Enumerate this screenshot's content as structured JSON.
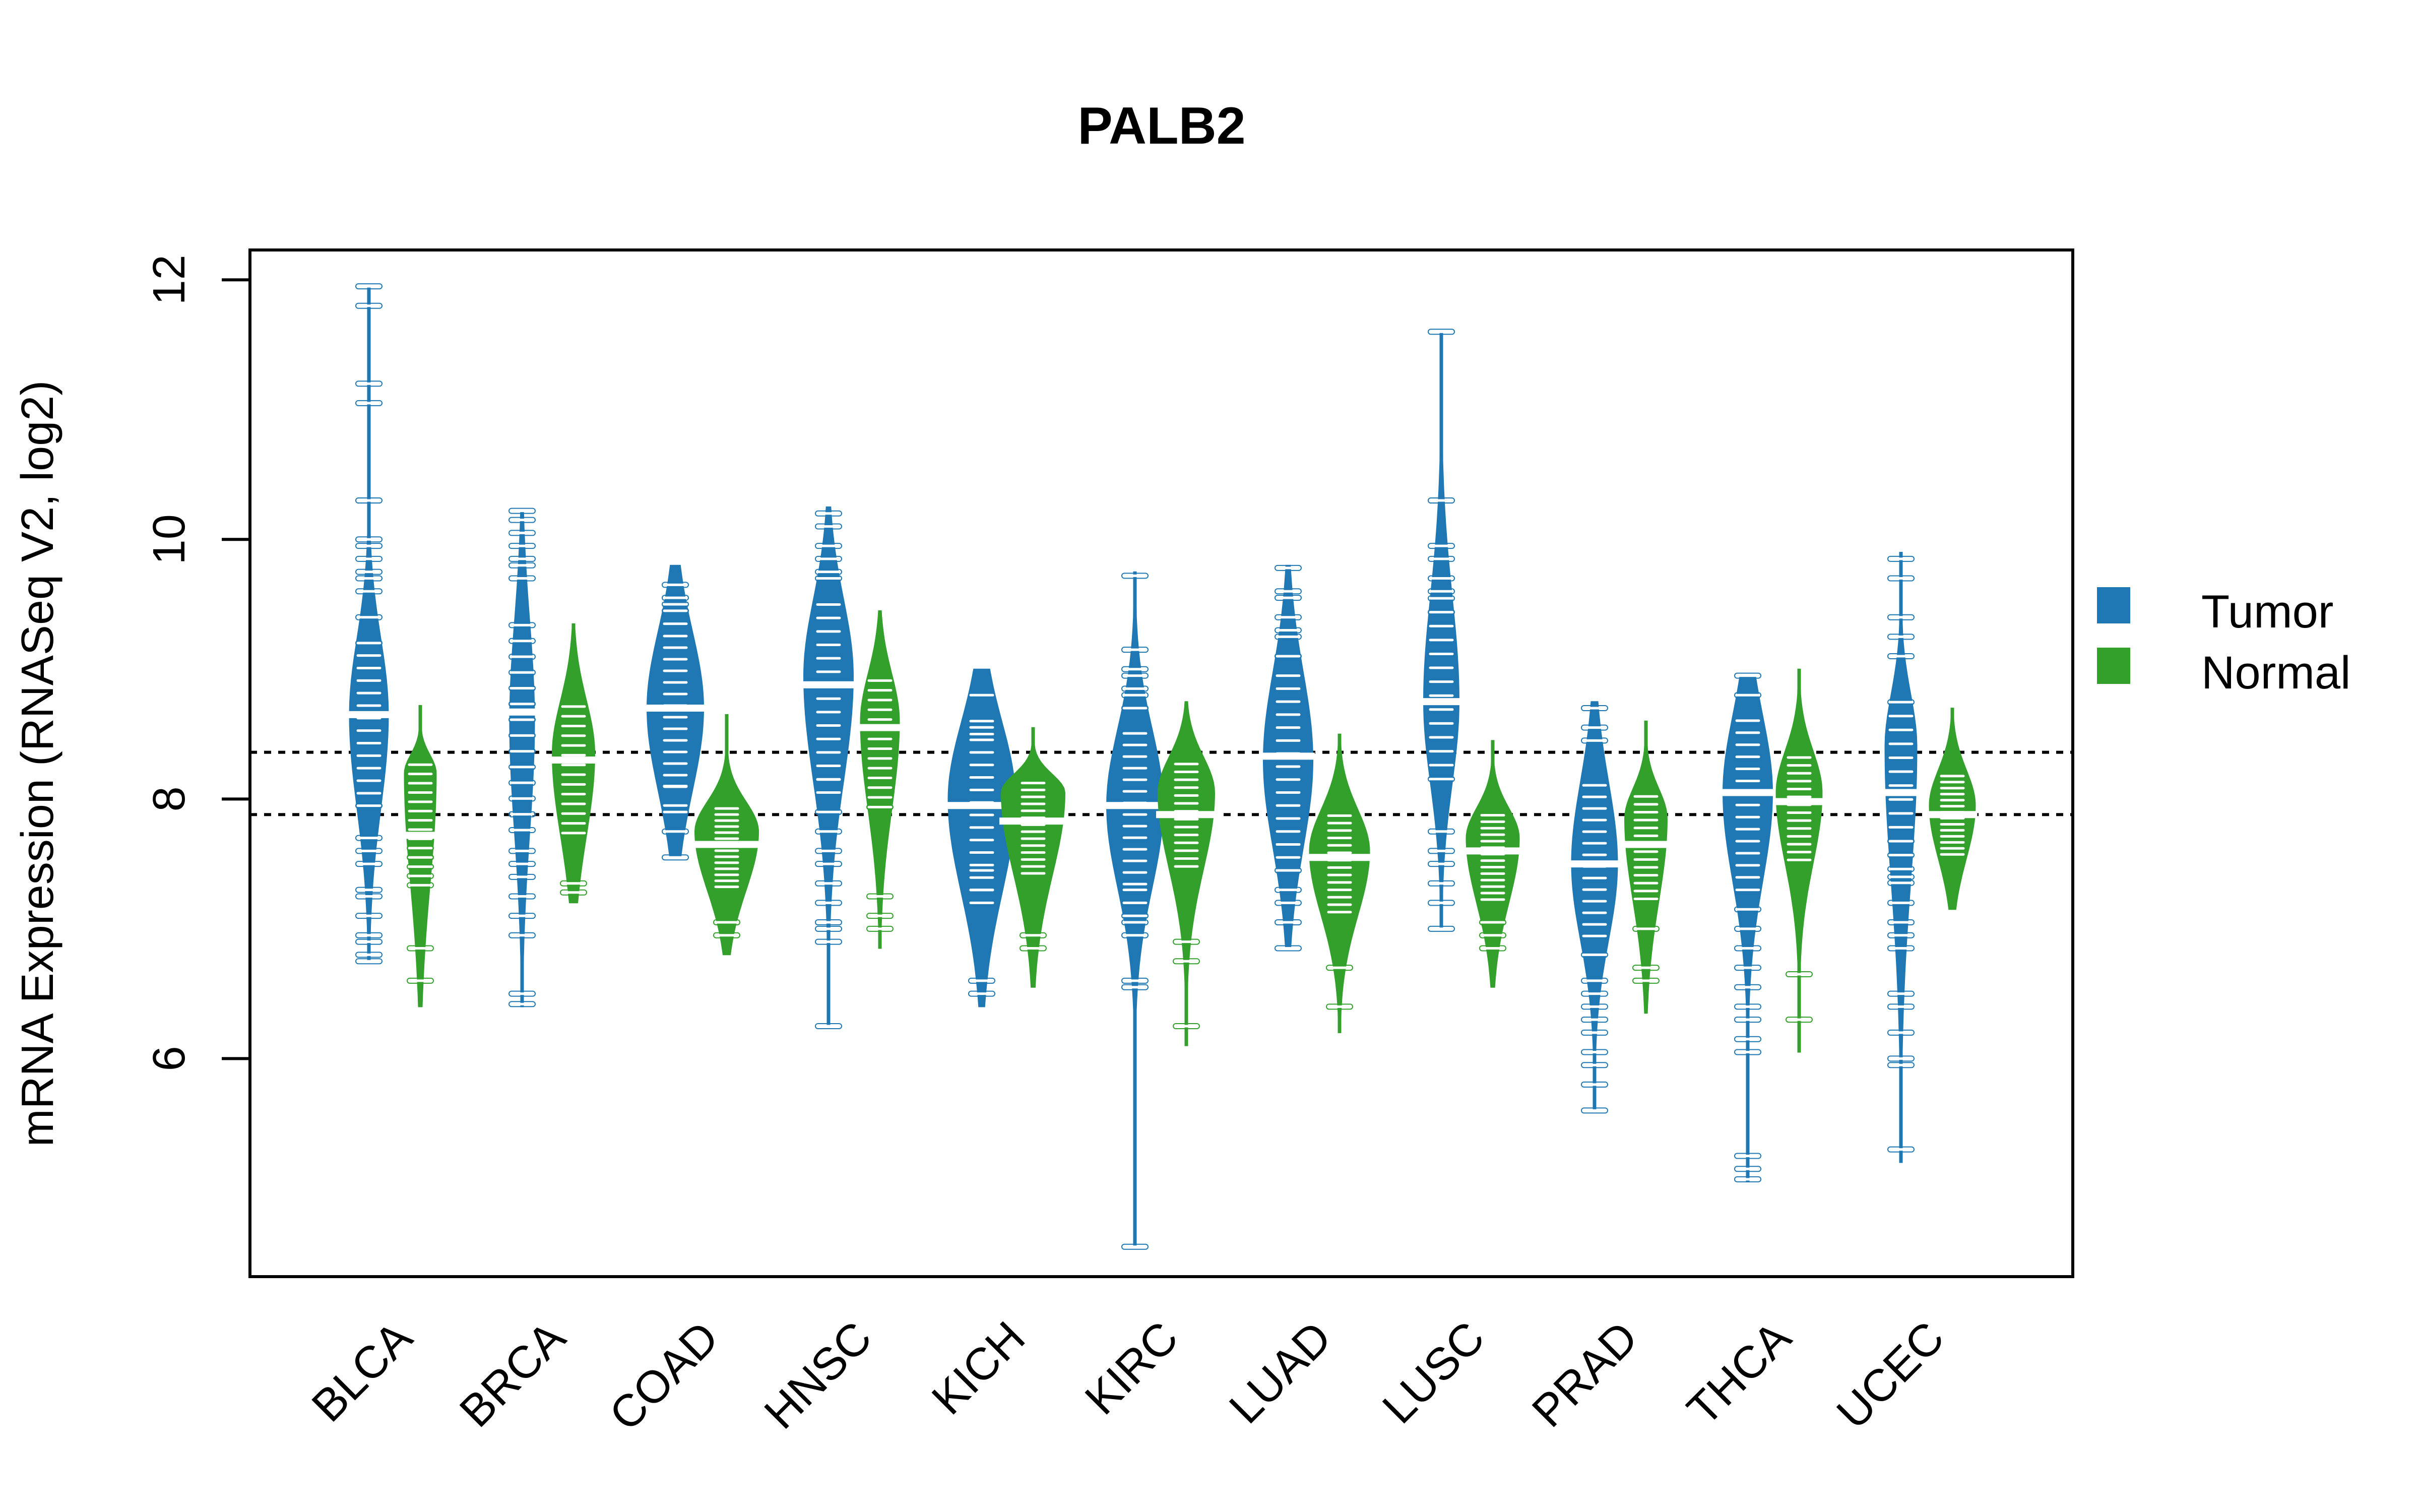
{
  "chart_data": {
    "type": "beanplot",
    "title": "PALB2",
    "xlabel": "",
    "ylabel": "mRNA Expression (RNASeq V2, log2)",
    "ylim": [
      4.32,
      12.23
    ],
    "yticks": [
      6,
      8,
      10,
      12
    ],
    "grid": false,
    "legend_position": "right",
    "reference_lines": [
      8.36,
      7.88
    ],
    "categories": [
      "BLCA",
      "BRCA",
      "COAD",
      "HNSC",
      "KICH",
      "KIRC",
      "LUAD",
      "LUSC",
      "PRAD",
      "THCA",
      "UCEC"
    ],
    "series": [
      {
        "name": "Tumor",
        "color": "#1f78b4",
        "median": [
          8.65,
          8.67,
          8.7,
          8.88,
          7.95,
          7.95,
          8.33,
          8.75,
          7.5,
          8.05,
          8.05
        ],
        "min": [
          6.75,
          6.4,
          7.55,
          6.25,
          6.4,
          4.55,
          6.85,
          7.0,
          5.6,
          5.05,
          5.2
        ],
        "max": [
          11.95,
          10.22,
          9.8,
          10.25,
          9.0,
          9.75,
          9.8,
          11.6,
          8.75,
          8.95,
          9.9
        ],
        "q_low": [
          7.9,
          7.7,
          8.05,
          8.1,
          7.25,
          7.3,
          7.6,
          8.1,
          6.9,
          7.35,
          7.3
        ],
        "q_high": [
          9.25,
          9.4,
          9.3,
          9.55,
          8.6,
          8.55,
          9.0,
          9.6,
          8.15,
          8.65,
          8.8
        ],
        "mode": [
          8.65,
          8.6,
          8.7,
          8.95,
          8.0,
          7.95,
          8.3,
          8.75,
          7.5,
          8.05,
          8.4
        ],
        "rel_width": [
          0.55,
          0.35,
          0.8,
          0.7,
          0.95,
          0.8,
          0.7,
          0.5,
          0.65,
          0.7,
          0.45
        ],
        "points": [
          [
            11.95,
            11.8,
            11.2,
            11.05,
            10.3,
            10.0,
            9.95,
            9.85,
            9.75,
            9.7,
            9.6,
            9.4,
            7.7,
            7.6,
            7.5,
            7.3,
            7.25,
            7.1,
            6.95,
            6.9,
            6.8,
            6.75
          ],
          [
            10.22,
            10.15,
            10.05,
            9.95,
            9.85,
            9.8,
            9.7,
            7.6,
            7.5,
            7.4,
            7.25,
            7.1,
            6.95,
            6.5,
            6.42
          ],
          [
            9.65,
            9.55,
            9.5,
            9.45,
            9.35,
            8.1,
            7.95,
            7.9,
            7.75,
            7.55
          ],
          [
            10.2,
            10.1,
            9.95,
            9.85,
            9.75,
            9.7,
            8.15,
            8.05,
            7.9,
            7.75,
            7.6,
            7.5,
            7.35,
            7.2,
            7.05,
            7.0,
            6.9,
            6.25
          ],
          [
            8.8,
            8.6,
            8.5,
            7.45,
            7.3,
            7.2,
            6.6,
            6.5
          ],
          [
            9.72,
            9.15,
            9.0,
            8.95,
            8.85,
            8.8,
            8.7,
            7.3,
            7.2,
            7.1,
            7.05,
            6.95,
            6.6,
            6.55,
            4.55
          ],
          [
            9.78,
            9.6,
            9.55,
            9.4,
            9.3,
            9.25,
            9.1,
            7.65,
            7.55,
            7.45,
            7.3,
            7.2,
            7.05,
            6.85
          ],
          [
            11.6,
            10.3,
            9.95,
            9.85,
            9.7,
            9.6,
            7.75,
            7.6,
            7.5,
            7.35,
            7.2,
            7.0
          ],
          [
            8.7,
            8.55,
            8.45,
            6.8,
            6.6,
            6.5,
            6.4,
            6.3,
            6.2,
            6.05,
            5.95,
            5.8,
            5.6
          ],
          [
            8.95,
            8.8,
            7.3,
            7.15,
            7.0,
            6.85,
            6.7,
            6.55,
            6.4,
            6.3,
            6.15,
            6.05,
            5.25,
            5.15,
            5.07
          ],
          [
            9.85,
            9.7,
            9.4,
            9.25,
            9.1,
            7.4,
            7.2,
            7.05,
            6.95,
            6.85,
            6.5,
            6.4,
            6.2,
            6.0,
            5.95,
            5.3
          ]
        ]
      },
      {
        "name": "Normal",
        "color": "#33a02c",
        "median": [
          7.72,
          8.3,
          7.65,
          8.55,
          7.83,
          7.88,
          7.55,
          7.6,
          7.65,
          7.98,
          7.88
        ],
        "min": [
          6.4,
          7.2,
          6.8,
          6.85,
          6.55,
          6.1,
          6.2,
          6.55,
          6.35,
          6.05,
          7.15
        ],
        "max": [
          8.72,
          9.35,
          8.65,
          9.45,
          8.55,
          8.75,
          8.5,
          8.45,
          8.6,
          9.0,
          8.7
        ],
        "q_low": [
          7.3,
          7.7,
          7.3,
          7.9,
          7.4,
          7.45,
          7.1,
          7.2,
          7.2,
          7.5,
          7.55
        ],
        "q_high": [
          8.3,
          8.75,
          7.95,
          8.95,
          8.15,
          8.3,
          7.9,
          7.9,
          8.05,
          8.35,
          8.2
        ],
        "mode": [
          8.2,
          8.35,
          7.75,
          8.6,
          8.05,
          8.05,
          7.6,
          7.7,
          7.85,
          8.05,
          7.95
        ],
        "rel_width": [
          0.45,
          0.6,
          0.9,
          0.55,
          0.9,
          0.8,
          0.85,
          0.75,
          0.6,
          0.65,
          0.65
        ],
        "points": [
          [
            6.85,
            6.6
          ],
          [
            7.35,
            7.28
          ],
          [
            7.05,
            6.95
          ],
          [
            7.25,
            7.1,
            7.0
          ],
          [
            6.95,
            6.85
          ],
          [
            6.9,
            6.75,
            6.25
          ],
          [
            6.7,
            6.4
          ],
          [
            7.05,
            6.95,
            6.85
          ],
          [
            7.0,
            6.7,
            6.6
          ],
          [
            6.65,
            6.3
          ],
          []
        ]
      }
    ]
  }
}
